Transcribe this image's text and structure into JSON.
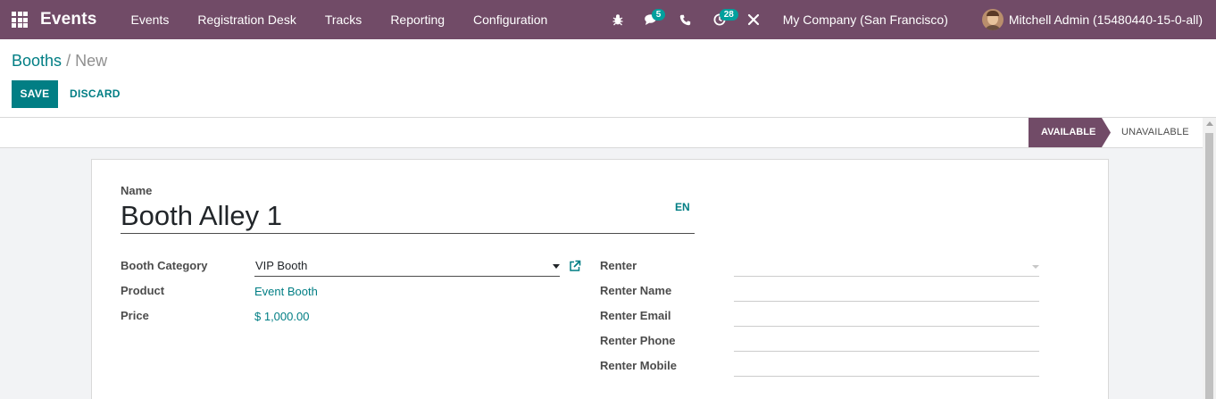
{
  "navbar": {
    "app_name": "Events",
    "menu": [
      "Events",
      "Registration Desk",
      "Tracks",
      "Reporting",
      "Configuration"
    ],
    "messages_count": "5",
    "activities_count": "28",
    "company": "My Company (San Francisco)",
    "user": "Mitchell Admin (15480440-15-0-all)"
  },
  "breadcrumb": {
    "parent": "Booths",
    "separator": "/",
    "current": "New"
  },
  "buttons": {
    "save": "SAVE",
    "discard": "DISCARD"
  },
  "statusbar": {
    "stages": [
      "AVAILABLE",
      "UNAVAILABLE"
    ],
    "active": "AVAILABLE"
  },
  "form": {
    "name_label": "Name",
    "name_value": "Booth Alley 1",
    "lang": "EN",
    "left": {
      "booth_category_label": "Booth Category",
      "booth_category_value": "VIP Booth",
      "product_label": "Product",
      "product_value": "Event Booth",
      "price_label": "Price",
      "price_value": "$ 1,000.00"
    },
    "right": {
      "renter_label": "Renter",
      "renter_name_label": "Renter Name",
      "renter_email_label": "Renter Email",
      "renter_phone_label": "Renter Phone",
      "renter_mobile_label": "Renter Mobile"
    }
  },
  "colors": {
    "brand": "#714b67",
    "accent": "#017e84",
    "badge": "#00a09d"
  },
  "icons": [
    "apps-icon",
    "bug-icon",
    "chat-icon",
    "phone-icon",
    "activity-icon",
    "tools-icon",
    "external-link-icon"
  ]
}
